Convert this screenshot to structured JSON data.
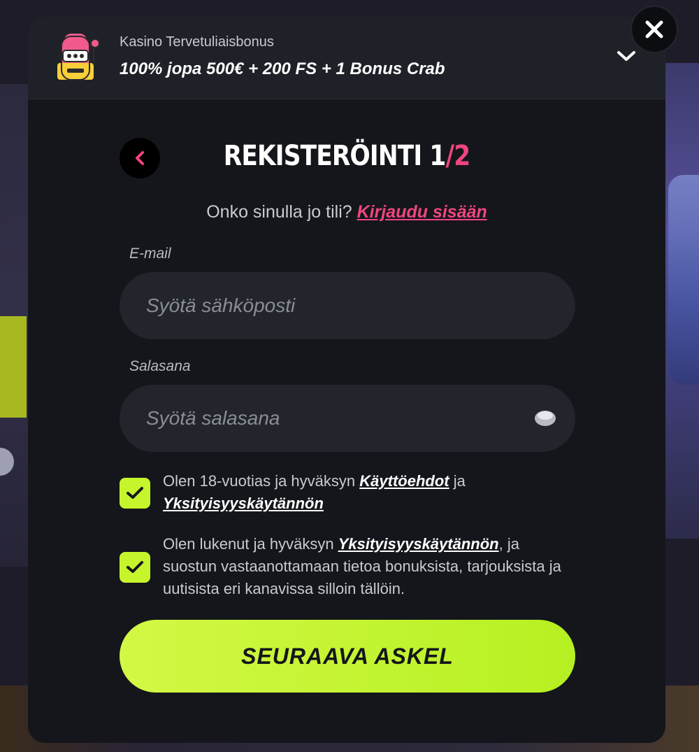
{
  "colors": {
    "accent_pink": "#f0457f",
    "accent_lime": "#c6f52c",
    "modal_bg": "#14161b",
    "input_bg": "#22252c"
  },
  "header": {
    "icon": "slot-machine-icon",
    "bonus_label": "Kasino Tervetuliaisbonus",
    "bonus_title": "100% jopa 500€ + 200 FS + 1 Bonus Crab",
    "toggle_icon": "chevron-down-icon"
  },
  "close_icon": "close-icon",
  "title": {
    "back_icon": "chevron-left-icon",
    "text": "REKISTERÖINTI",
    "step_current": "1",
    "step_sep": "/",
    "step_total": "2"
  },
  "login": {
    "question": "Onko sinulla jo tili?",
    "link": "Kirjaudu sisään"
  },
  "form": {
    "email": {
      "label": "E-mail",
      "placeholder": "Syötä sähköposti",
      "value": ""
    },
    "password": {
      "label": "Salasana",
      "placeholder": "Syötä salasana",
      "value": "",
      "toggle_icon": "eye-icon"
    }
  },
  "consents": [
    {
      "checked": true,
      "pre": "Olen 18-vuotias ja hyväksyn ",
      "link1": "Käyttöehdot",
      "mid": " ja ",
      "link2": "Yksityisyyskäytännön",
      "post": ""
    },
    {
      "checked": true,
      "pre": "Olen lukenut ja hyväksyn ",
      "link1": "Yksityisyyskäytännön",
      "post": ", ja suostun vastaanottamaan tietoa bonuksista, tarjouksista ja uutisista eri kanavissa silloin tällöin."
    }
  ],
  "submit_label": "SEURAAVA ASKEL"
}
